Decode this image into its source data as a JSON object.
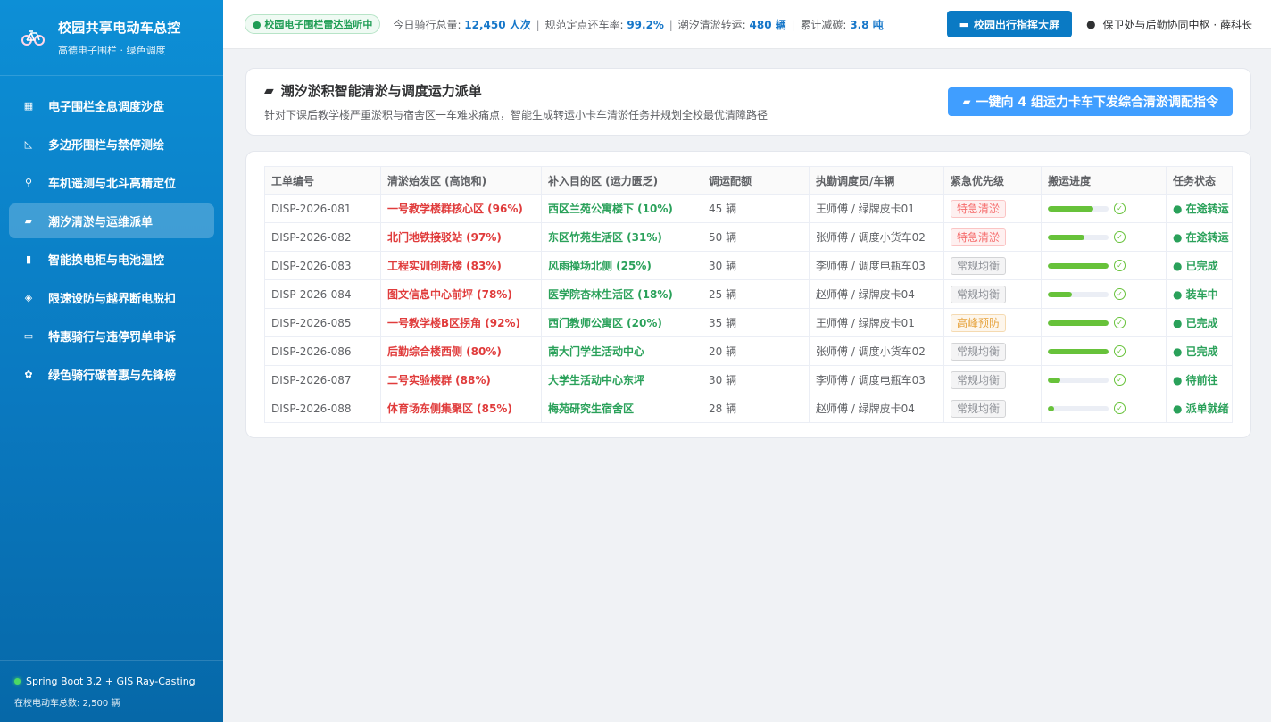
{
  "sidebar": {
    "title": "校园共享电动车总控",
    "subtitle": "高德电子围栏 · 绿色调度",
    "items": [
      {
        "label": "电子围栏全息调度沙盘",
        "icon": "map-icon",
        "glyph": "▦",
        "active": false
      },
      {
        "label": "多边形围栏与禁停测绘",
        "icon": "ruler-icon",
        "glyph": "◺",
        "active": false
      },
      {
        "label": "车机遥测与北斗高精定位",
        "icon": "scooter-icon",
        "glyph": "⚲",
        "active": false
      },
      {
        "label": "潮汐清淤与运维派单",
        "icon": "truck-icon",
        "glyph": "▰",
        "active": true
      },
      {
        "label": "智能换电柜与电池温控",
        "icon": "battery-icon",
        "glyph": "▮",
        "active": false
      },
      {
        "label": "限速设防与越界断电脱扣",
        "icon": "shield-icon",
        "glyph": "◈",
        "active": false
      },
      {
        "label": "特惠骑行与违停罚单申诉",
        "icon": "card-icon",
        "glyph": "▭",
        "active": false
      },
      {
        "label": "绿色骑行碳普惠与先锋榜",
        "icon": "sprout-icon",
        "glyph": "✿",
        "active": false
      }
    ],
    "footer": {
      "tech": "Spring Boot 3.2 + GIS Ray-Casting",
      "count": "在校电动车总数: 2,500 辆"
    }
  },
  "topbar": {
    "radar_tag": "● 校园电子围栏雷达监听中",
    "stats": [
      {
        "label": "今日骑行总量: ",
        "value": "12,450 人次"
      },
      {
        "label": "规范定点还车率: ",
        "value": "99.2%"
      },
      {
        "label": "潮汐清淤转运: ",
        "value": "480 辆"
      },
      {
        "label": "累计减碳: ",
        "value": "3.8 吨"
      }
    ],
    "screen_button": "校园出行指挥大屏",
    "user": "保卫处与后勤协同中枢 · 薛科长"
  },
  "header": {
    "title": "潮汐淤积智能清淤与调度运力派单",
    "subtitle": "针对下课后教学楼严重淤积与宿舍区一车难求痛点，智能生成转运小卡车清淤任务并规划全校最优清障路径",
    "dispatch_button": "一键向 4 组运力卡车下发综合清淤调配指令"
  },
  "table": {
    "columns": [
      "工单编号",
      "清淤始发区 (高饱和)",
      "补入目的区 (运力匮乏)",
      "调运配额",
      "执勤调度员/车辆",
      "紧急优先级",
      "搬运进度",
      "任务状态"
    ],
    "rows": [
      {
        "id": "DISP-2026-081",
        "source": "一号教学楼群核心区 (96%)",
        "dest": "西区兰苑公寓楼下 (10%)",
        "quota": "45 辆",
        "driver": "王师傅 / 绿牌皮卡01",
        "priority": "特急清淤",
        "ptype": "urgent",
        "progress": 0.75,
        "status": "● 在途转运"
      },
      {
        "id": "DISP-2026-082",
        "source": "北门地铁接驳站 (97%)",
        "dest": "东区竹苑生活区 (31%)",
        "quota": "50 辆",
        "driver": "张师傅 / 调度小货车02",
        "priority": "特急清淤",
        "ptype": "urgent",
        "progress": 0.6,
        "status": "● 在途转运"
      },
      {
        "id": "DISP-2026-083",
        "source": "工程实训创新楼 (83%)",
        "dest": "风雨操场北侧 (25%)",
        "quota": "30 辆",
        "driver": "李师傅 / 调度电瓶车03",
        "priority": "常规均衡",
        "ptype": "normal",
        "progress": 1.0,
        "status": "● 已完成"
      },
      {
        "id": "DISP-2026-084",
        "source": "图文信息中心前坪 (78%)",
        "dest": "医学院杏林生活区 (18%)",
        "quota": "25 辆",
        "driver": "赵师傅 / 绿牌皮卡04",
        "priority": "常规均衡",
        "ptype": "normal",
        "progress": 0.4,
        "status": "● 装车中"
      },
      {
        "id": "DISP-2026-085",
        "source": "一号教学楼B区拐角 (92%)",
        "dest": "西门教师公寓区 (20%)",
        "quota": "35 辆",
        "driver": "王师傅 / 绿牌皮卡01",
        "priority": "高峰预防",
        "ptype": "peak",
        "progress": 1.0,
        "status": "● 已完成"
      },
      {
        "id": "DISP-2026-086",
        "source": "后勤综合楼西侧 (80%)",
        "dest": "南大门学生活动中心",
        "quota": "20 辆",
        "driver": "张师傅 / 调度小货车02",
        "priority": "常规均衡",
        "ptype": "normal",
        "progress": 1.0,
        "status": "● 已完成"
      },
      {
        "id": "DISP-2026-087",
        "source": "二号实验楼群 (88%)",
        "dest": "大学生活动中心东坪",
        "quota": "30 辆",
        "driver": "李师傅 / 调度电瓶车03",
        "priority": "常规均衡",
        "ptype": "normal",
        "progress": 0.2,
        "status": "● 待前往"
      },
      {
        "id": "DISP-2026-088",
        "source": "体育场东侧集聚区 (85%)",
        "dest": "梅苑研究生宿舍区",
        "quota": "28 辆",
        "driver": "赵师傅 / 绿牌皮卡04",
        "priority": "常规均衡",
        "ptype": "normal",
        "progress": 0.1,
        "status": "● 派单就绪"
      }
    ]
  },
  "colors": {
    "sidebar": "#0a79c0",
    "accent": "#409eff",
    "source_red": "#e03c3c",
    "dest_green": "#2aa15a",
    "progress": "#67c23a"
  },
  "priority_styles": {
    "urgent": {
      "color": "#f56c6c",
      "bg": "#fef0f0",
      "border": "#fbc4c4"
    },
    "normal": {
      "color": "#909399",
      "bg": "#f4f4f5",
      "border": "#d3d4d6"
    },
    "peak": {
      "color": "#e6a23c",
      "bg": "#fdf6ec",
      "border": "#f5dab1"
    }
  }
}
